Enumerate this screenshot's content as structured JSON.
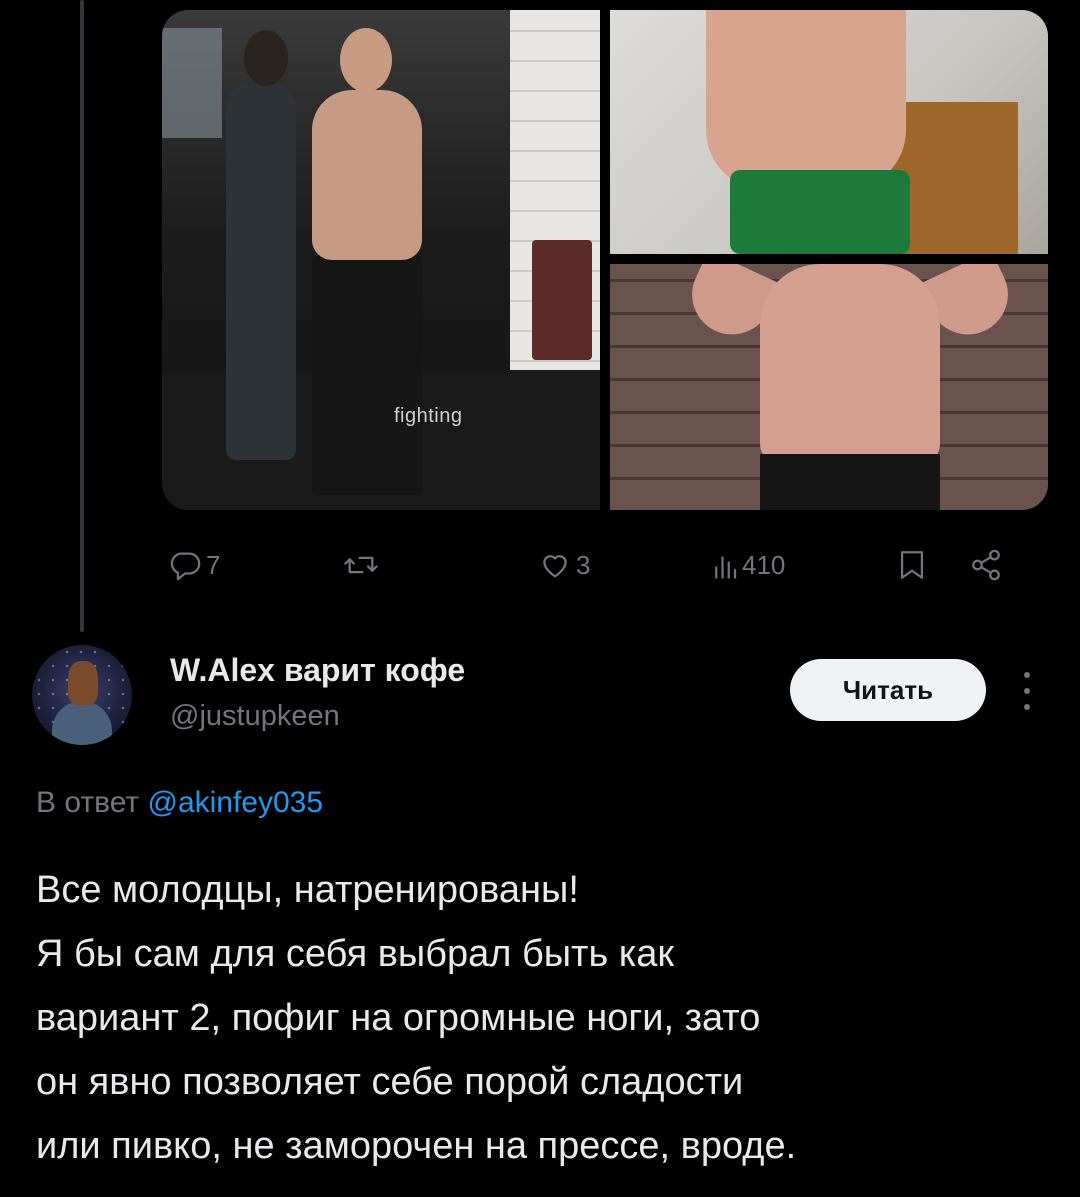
{
  "previous_tweet": {
    "media_overlay_text": "fighting",
    "actions": {
      "reply_count": "7",
      "retweet_count": "",
      "like_count": "3",
      "views_count": "410"
    }
  },
  "reply_tweet": {
    "display_name": "W.Alex варит кофе",
    "handle": "@justupkeen",
    "follow_label": "Читать",
    "reply_to_prefix": "В ответ",
    "reply_to_mention": "@akinfey035",
    "text_lines": [
      "Все молодцы, натренированы!",
      "Я бы сам для себя выбрал быть как",
      "вариант 2, пофиг на огромные ноги, зато",
      "он явно позволяет себе порой сладости",
      "или пивко, не заморочен на прессе, вроде."
    ]
  },
  "icons": [
    "reply-icon",
    "retweet-icon",
    "like-icon",
    "views-icon",
    "bookmark-icon",
    "share-icon",
    "more-icon"
  ],
  "colors": {
    "background": "#000000",
    "text_primary": "#e7e9ea",
    "text_secondary": "#71767b",
    "link": "#1d9bf0",
    "follow_button_bg": "#eff3f4"
  }
}
